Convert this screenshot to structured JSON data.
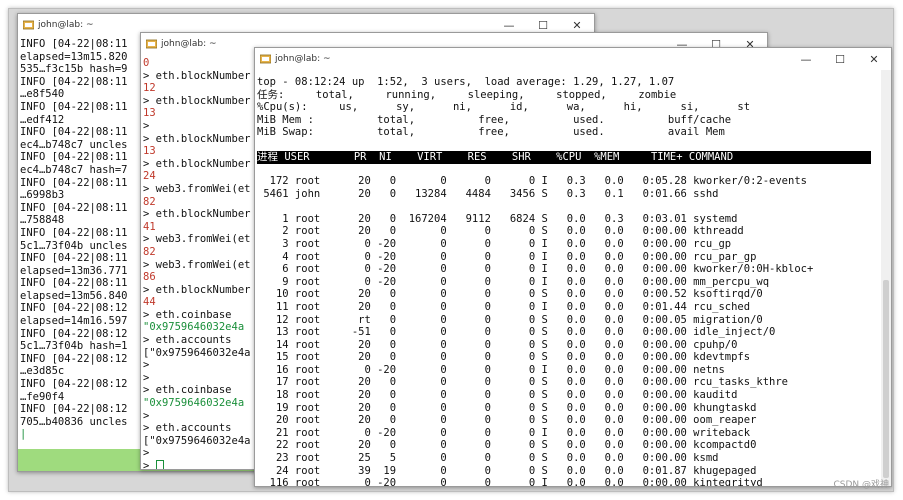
{
  "windows": {
    "w1": {
      "title": "john@lab: ~",
      "lines": [
        {
          "t": "INFO [04-22|08:11"
        },
        {
          "t": "elapsed=13m15.820"
        },
        {
          "t": "535…f3c15b hash=9"
        },
        {
          "t": "INFO [04-22|08:11"
        },
        {
          "t": "…e8f540"
        },
        {
          "t": "INFO [04-22|08:11"
        },
        {
          "t": "…edf412"
        },
        {
          "t": "INFO [04-22|08:11"
        },
        {
          "t": "ec4…b748c7 uncles"
        },
        {
          "t": "INFO [04-22|08:11"
        },
        {
          "t": "ec4…b748c7 hash=7"
        },
        {
          "t": "INFO [04-22|08:11"
        },
        {
          "t": "…6998b3"
        },
        {
          "t": "INFO [04-22|08:11"
        },
        {
          "t": "…758848"
        },
        {
          "t": "INFO [04-22|08:11"
        },
        {
          "t": "5c1…73f04b uncles"
        },
        {
          "t": "INFO [04-22|08:11"
        },
        {
          "t": "elapsed=13m36.771"
        },
        {
          "t": "INFO [04-22|08:11"
        },
        {
          "t": "elapsed=13m56.840"
        },
        {
          "t": "INFO [04-22|08:12"
        },
        {
          "t": "elapsed=14m16.597"
        },
        {
          "t": "INFO [04-22|08:12"
        },
        {
          "t": "5c1…73f04b hash=1"
        },
        {
          "t": "INFO [04-22|08:12"
        },
        {
          "t": "…e3d85c"
        },
        {
          "t": "INFO [04-22|08:12"
        },
        {
          "t": "…fe90f4"
        },
        {
          "t": "INFO [04-22|08:12"
        },
        {
          "t": "705…b40836 uncles"
        },
        {
          "t": "|",
          "c": "green"
        }
      ]
    },
    "w2": {
      "title": "john@lab: ~",
      "lines": [
        {
          "t": "0",
          "c": "red"
        },
        {
          "t": "> eth.blockNumber"
        },
        {
          "t": "12",
          "c": "red"
        },
        {
          "t": "> eth.blockNumber"
        },
        {
          "t": "13",
          "c": "red"
        },
        {
          "t": ">"
        },
        {
          "t": "> eth.blockNumber"
        },
        {
          "t": "13",
          "c": "red"
        },
        {
          "t": "> eth.blockNumber"
        },
        {
          "t": "24",
          "c": "red"
        },
        {
          "t": "> web3.fromWei(et"
        },
        {
          "t": "82",
          "c": "red"
        },
        {
          "t": "> eth.blockNumber"
        },
        {
          "t": "41",
          "c": "red"
        },
        {
          "t": "> web3.fromWei(et"
        },
        {
          "t": "82",
          "c": "red"
        },
        {
          "t": "> web3.fromWei(et"
        },
        {
          "t": "86",
          "c": "red"
        },
        {
          "t": "> eth.blockNumber"
        },
        {
          "t": "44",
          "c": "red"
        },
        {
          "t": "> eth.coinbase"
        },
        {
          "t": "\"0x9759646032e4a",
          "c": "green"
        },
        {
          "t": "> eth.accounts"
        },
        {
          "t": "[\"0x9759646032e4a"
        },
        {
          "t": ">"
        },
        {
          "t": ">"
        },
        {
          "t": "> eth.coinbase"
        },
        {
          "t": "\"0x9759646032e4a",
          "c": "green"
        },
        {
          "t": ">"
        },
        {
          "t": "> eth.accounts"
        },
        {
          "t": "[\"0x9759646032e4a"
        },
        {
          "t": ">"
        },
        {
          "t": "> "
        }
      ]
    },
    "w3": {
      "title": "john@lab: ~",
      "top": [
        "top - 08:12:24 up  1:52,  3 users,  load average: 1.29, 1.27, 1.07",
        "任务:     total,     running,     sleeping,     stopped,     zombie",
        "%Cpu(s):     us,      sy,      ni,      id,      wa,      hi,      si,      st",
        "MiB Mem :          total,          free,          used.          buff/cache",
        "MiB Swap:          total,          free,          used.          avail Mem"
      ],
      "header": "进程 USER       PR  NI    VIRT    RES    SHR    %CPU  %MEM     TIME+ COMMAND",
      "procs": [
        "  172 root      20   0       0      0      0 I   0.3   0.0   0:05.28 kworker/0:2-events",
        " 5461 john      20   0   13284   4484   3456 S   0.3   0.1   0:01.66 sshd",
        "",
        "    1 root      20   0  167204   9112   6824 S   0.0   0.3   0:03.01 systemd",
        "    2 root      20   0       0      0      0 S   0.0   0.0   0:00.00 kthreadd",
        "    3 root       0 -20       0      0      0 I   0.0   0.0   0:00.00 rcu_gp",
        "    4 root       0 -20       0      0      0 I   0.0   0.0   0:00.00 rcu_par_gp",
        "    6 root       0 -20       0      0      0 I   0.0   0.0   0:00.00 kworker/0:0H-kbloc+",
        "    9 root       0 -20       0      0      0 I   0.0   0.0   0:00.00 mm_percpu_wq",
        "   10 root      20   0       0      0      0 S   0.0   0.0   0:00.52 ksoftirqd/0",
        "   11 root      20   0       0      0      0 I   0.0   0.0   0:01.44 rcu_sched",
        "   12 root      rt   0       0      0      0 S   0.0   0.0   0:00.05 migration/0",
        "   13 root     -51   0       0      0      0 S   0.0   0.0   0:00.00 idle_inject/0",
        "   14 root      20   0       0      0      0 S   0.0   0.0   0:00.00 cpuhp/0",
        "   15 root      20   0       0      0      0 S   0.0   0.0   0:00.00 kdevtmpfs",
        "   16 root       0 -20       0      0      0 I   0.0   0.0   0:00.00 netns",
        "   17 root      20   0       0      0      0 S   0.0   0.0   0:00.00 rcu_tasks_kthre",
        "   18 root      20   0       0      0      0 S   0.0   0.0   0:00.00 kauditd",
        "   19 root      20   0       0      0      0 S   0.0   0.0   0:00.00 khungtaskd",
        "   20 root      20   0       0      0      0 S   0.0   0.0   0:00.00 oom_reaper",
        "   21 root       0 -20       0      0      0 I   0.0   0.0   0:00.00 writeback",
        "   22 root      20   0       0      0      0 S   0.0   0.0   0:00.00 kcompactd0",
        "   23 root      25   5       0      0      0 S   0.0   0.0   0:00.00 ksmd",
        "   24 root      39  19       0      0      0 S   0.0   0.0   0:01.87 khugepaged",
        "  116 root       0 -20       0      0      0 I   0.0   0.0   0:00.00 kintegrityd"
      ]
    }
  },
  "controls": {
    "minimize": "—",
    "maximize": "☐",
    "close": "✕"
  },
  "watermark": "CSDN @戏神"
}
